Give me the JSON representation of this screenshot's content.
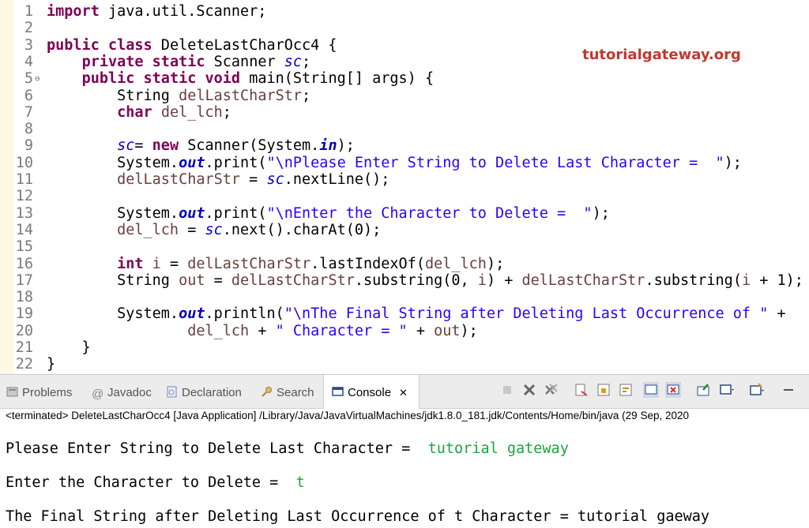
{
  "editor": {
    "watermark": "tutorialgateway.org",
    "lines": [
      {
        "n": "1",
        "tokens": [
          {
            "t": "import",
            "c": "kw"
          },
          {
            "t": " java.util.Scanner;"
          }
        ]
      },
      {
        "n": "2",
        "tokens": []
      },
      {
        "n": "3",
        "tokens": [
          {
            "t": "public",
            "c": "kw"
          },
          {
            "t": " "
          },
          {
            "t": "class",
            "c": "kw"
          },
          {
            "t": " DeleteLastCharOcc4 {"
          }
        ]
      },
      {
        "n": "4",
        "tokens": [
          {
            "t": "    "
          },
          {
            "t": "private",
            "c": "kw"
          },
          {
            "t": " "
          },
          {
            "t": "static",
            "c": "kw"
          },
          {
            "t": " Scanner "
          },
          {
            "t": "sc",
            "c": "fld"
          },
          {
            "t": ";"
          }
        ]
      },
      {
        "n": "5",
        "fold": "⊖",
        "tokens": [
          {
            "t": "    "
          },
          {
            "t": "public",
            "c": "kw"
          },
          {
            "t": " "
          },
          {
            "t": "static",
            "c": "kw"
          },
          {
            "t": " "
          },
          {
            "t": "void",
            "c": "kw"
          },
          {
            "t": " main(String[] args) {"
          }
        ]
      },
      {
        "n": "6",
        "tokens": [
          {
            "t": "        String "
          },
          {
            "t": "delLastCharStr",
            "c": "var"
          },
          {
            "t": ";"
          }
        ]
      },
      {
        "n": "7",
        "tokens": [
          {
            "t": "        "
          },
          {
            "t": "char",
            "c": "kw"
          },
          {
            "t": " "
          },
          {
            "t": "del_lch",
            "c": "var"
          },
          {
            "t": ";"
          }
        ]
      },
      {
        "n": "8",
        "tokens": []
      },
      {
        "n": "9",
        "tokens": [
          {
            "t": "        "
          },
          {
            "t": "sc",
            "c": "fld"
          },
          {
            "t": "= "
          },
          {
            "t": "new",
            "c": "kw"
          },
          {
            "t": " Scanner(System."
          },
          {
            "t": "in",
            "c": "sfld"
          },
          {
            "t": ");"
          }
        ]
      },
      {
        "n": "10",
        "tokens": [
          {
            "t": "        System."
          },
          {
            "t": "out",
            "c": "sfld"
          },
          {
            "t": ".print("
          },
          {
            "t": "\"\\nPlease Enter String to Delete Last Character =  \"",
            "c": "str"
          },
          {
            "t": ");"
          }
        ]
      },
      {
        "n": "11",
        "tokens": [
          {
            "t": "        "
          },
          {
            "t": "delLastCharStr",
            "c": "var"
          },
          {
            "t": " = "
          },
          {
            "t": "sc",
            "c": "fld"
          },
          {
            "t": ".nextLine();"
          }
        ]
      },
      {
        "n": "12",
        "tokens": []
      },
      {
        "n": "13",
        "tokens": [
          {
            "t": "        System."
          },
          {
            "t": "out",
            "c": "sfld"
          },
          {
            "t": ".print("
          },
          {
            "t": "\"\\nEnter the Character to Delete =  \"",
            "c": "str"
          },
          {
            "t": ");"
          }
        ]
      },
      {
        "n": "14",
        "tokens": [
          {
            "t": "        "
          },
          {
            "t": "del_lch",
            "c": "var"
          },
          {
            "t": " = "
          },
          {
            "t": "sc",
            "c": "fld"
          },
          {
            "t": ".next().charAt(0);"
          }
        ]
      },
      {
        "n": "15",
        "tokens": []
      },
      {
        "n": "16",
        "tokens": [
          {
            "t": "        "
          },
          {
            "t": "int",
            "c": "kw"
          },
          {
            "t": " "
          },
          {
            "t": "i",
            "c": "var"
          },
          {
            "t": " = "
          },
          {
            "t": "delLastCharStr",
            "c": "var"
          },
          {
            "t": ".lastIndexOf("
          },
          {
            "t": "del_lch",
            "c": "var"
          },
          {
            "t": ");"
          }
        ]
      },
      {
        "n": "17",
        "tokens": [
          {
            "t": "        String "
          },
          {
            "t": "out",
            "c": "var"
          },
          {
            "t": " = "
          },
          {
            "t": "delLastCharStr",
            "c": "var"
          },
          {
            "t": ".substring(0, "
          },
          {
            "t": "i",
            "c": "var"
          },
          {
            "t": ") + "
          },
          {
            "t": "delLastCharStr",
            "c": "var"
          },
          {
            "t": ".substring("
          },
          {
            "t": "i",
            "c": "var"
          },
          {
            "t": " + 1);"
          }
        ]
      },
      {
        "n": "18",
        "tokens": []
      },
      {
        "n": "19",
        "tokens": [
          {
            "t": "        System."
          },
          {
            "t": "out",
            "c": "sfld"
          },
          {
            "t": ".println("
          },
          {
            "t": "\"\\nThe Final String after Deleting Last Occurrence of \"",
            "c": "str"
          },
          {
            "t": " +"
          }
        ]
      },
      {
        "n": "20",
        "tokens": [
          {
            "t": "                "
          },
          {
            "t": "del_lch",
            "c": "var"
          },
          {
            "t": " + "
          },
          {
            "t": "\" Character = \"",
            "c": "str"
          },
          {
            "t": " + "
          },
          {
            "t": "out",
            "c": "var"
          },
          {
            "t": ");"
          }
        ]
      },
      {
        "n": "21",
        "tokens": [
          {
            "t": "    }"
          }
        ]
      },
      {
        "n": "22",
        "tokens": [
          {
            "t": "}"
          }
        ]
      }
    ]
  },
  "tabs": [
    {
      "id": "problems",
      "label": "Problems",
      "icon": "problems-icon"
    },
    {
      "id": "javadoc",
      "label": "Javadoc",
      "icon": "javadoc-icon"
    },
    {
      "id": "declaration",
      "label": "Declaration",
      "icon": "declaration-icon"
    },
    {
      "id": "search",
      "label": "Search",
      "icon": "search-icon"
    },
    {
      "id": "console",
      "label": "Console",
      "icon": "console-icon",
      "close": "✕"
    }
  ],
  "status": "<terminated> DeleteLastCharOcc4 [Java Application] /Library/Java/JavaVirtualMachines/jdk1.8.0_181.jdk/Contents/Home/bin/java  (29 Sep, 2020",
  "console": {
    "line1_prompt": "Please Enter String to Delete Last Character =  ",
    "line1_input": "tutorial gateway",
    "line2_prompt": "Enter the Character to Delete =  ",
    "line2_input": "t",
    "line3": "The Final String after Deleting Last Occurrence of t Character = tutorial gaeway"
  }
}
